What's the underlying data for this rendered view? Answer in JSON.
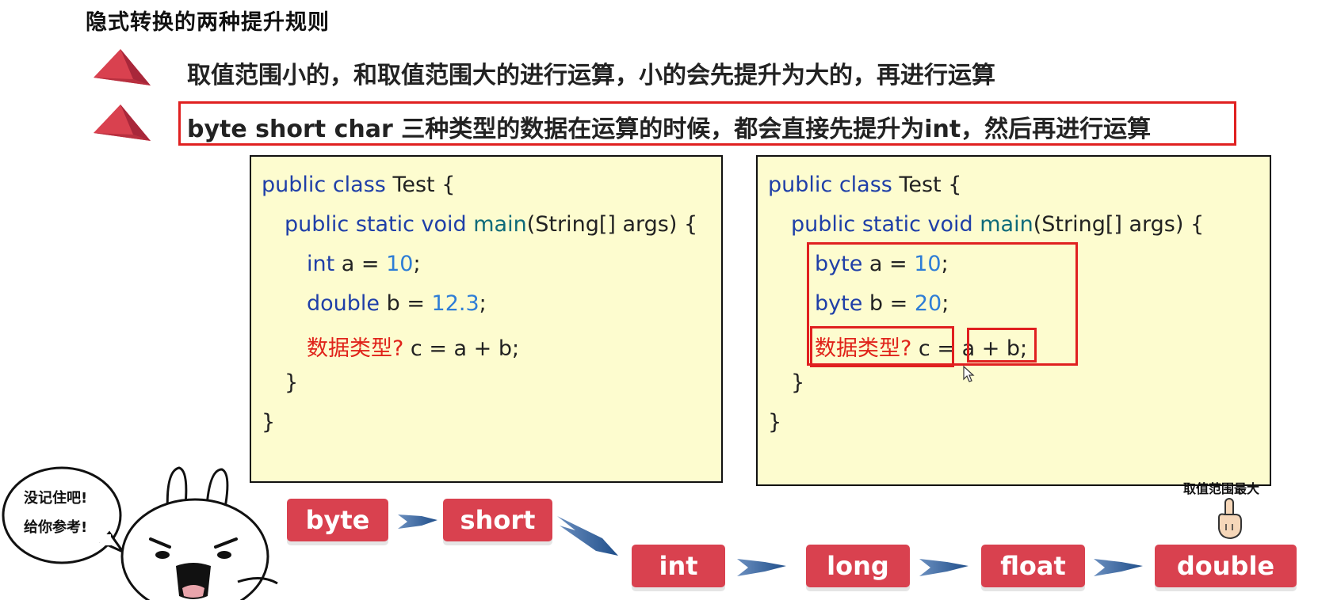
{
  "title": "隐式转换的两种提升规则",
  "rules": [
    "取值范围小的，和取值范围大的进行运算，小的会先提升为大的，再进行运算",
    "byte short char 三种类型的数据在运算的时候，都会直接先提升为int，然后再进行运算"
  ],
  "left_code": {
    "l1_kw": "public class",
    "l1_rest": " Test {",
    "l2_kw": "public static void",
    "l2_fn": " main",
    "l2_rest": "(String[] args) {",
    "l3_kw": "int",
    "l3_rest": " a = ",
    "l3_num": "10",
    "l3_end": ";",
    "l4_kw": "double",
    "l4_rest": " b = ",
    "l4_num": "12.3",
    "l4_end": ";",
    "l5_red": "数据类型?",
    "l5_rest": " c = a + b;",
    "l6": "}",
    "l7": "}"
  },
  "right_code": {
    "l1_kw": "public class",
    "l1_rest": " Test {",
    "l2_kw": "public static void",
    "l2_fn": " main",
    "l2_rest": "(String[] args) {",
    "l3_kw": "byte",
    "l3_rest": " a = ",
    "l3_num": "10",
    "l3_end": ";",
    "l4_kw": "byte",
    "l4_rest": " b = ",
    "l4_num": "20",
    "l4_end": ";",
    "l5_red": "数据类型?",
    "l5_c": " c =",
    "l5_expr": " a + b;",
    "l6": "}",
    "l7": "}"
  },
  "types": [
    "byte",
    "short",
    "int",
    "long",
    "float",
    "double"
  ],
  "max_label": "取值范围最大",
  "bubble": [
    "没记住吧!",
    "给你参考!"
  ],
  "colors": {
    "chip": "#d9414f",
    "highlight": "#e02020",
    "panel": "#fdfccf",
    "arrow": "#1f4e8a"
  }
}
